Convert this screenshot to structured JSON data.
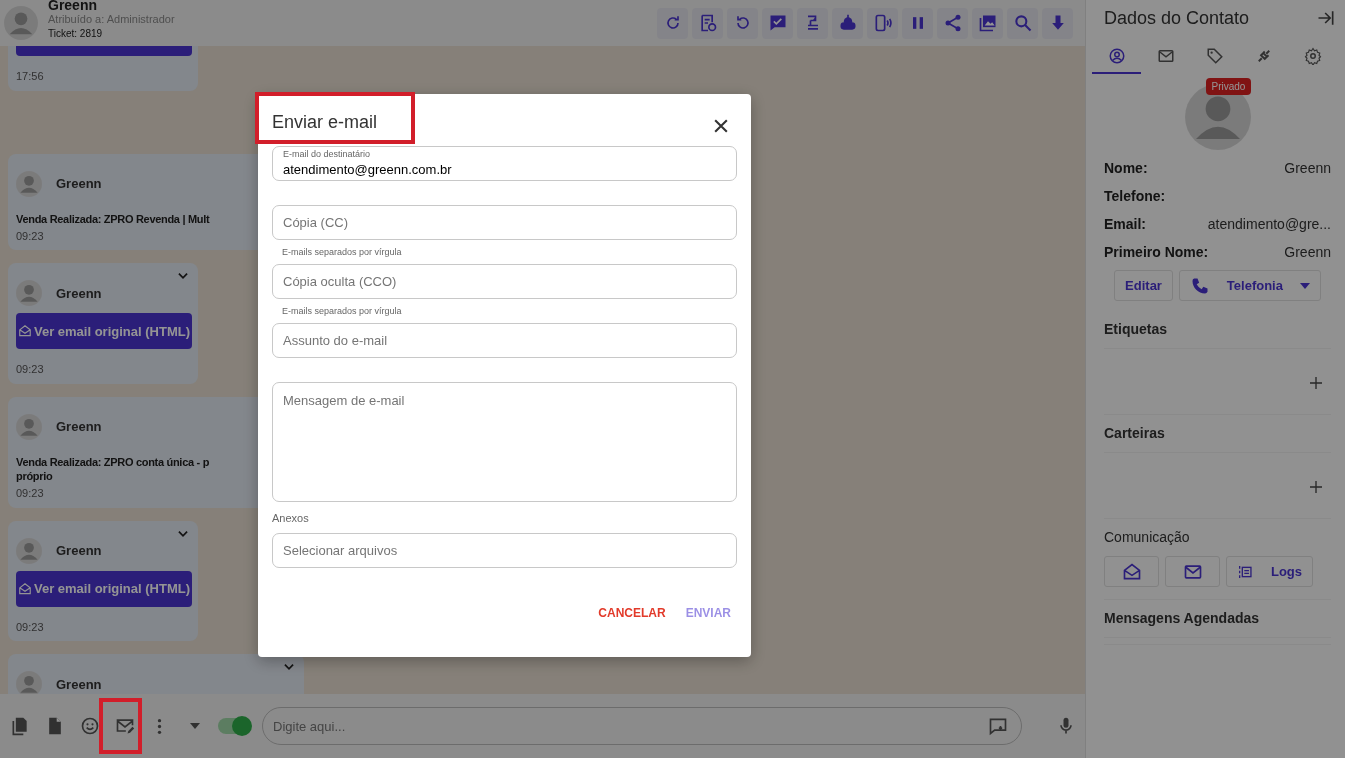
{
  "header": {
    "contact_name": "Greenn",
    "assigned": "Atribuído a: Administrador",
    "ticket": "Ticket: 2819"
  },
  "messages": [
    {
      "kind": "email_link_cut",
      "time": "17:56",
      "has_menu": false
    },
    {
      "kind": "text",
      "sender": "Greenn",
      "lines": [
        "Venda Realizada: ZPRO Revenda | Mult"
      ],
      "time": "09:23",
      "has_menu": false
    },
    {
      "kind": "email_link",
      "sender": "Greenn",
      "button": "Ver email original (HTML)",
      "time": "09:23",
      "has_menu": true
    },
    {
      "kind": "text",
      "sender": "Greenn",
      "lines": [
        "Venda Realizada: ZPRO conta única - p",
        "próprio"
      ],
      "time": "09:23",
      "has_menu": false
    },
    {
      "kind": "email_link",
      "sender": "Greenn",
      "button": "Ver email original (HTML)",
      "time": "09:23",
      "has_menu": true
    },
    {
      "kind": "partial",
      "sender": "Greenn",
      "has_menu": true
    }
  ],
  "composer": {
    "placeholder": "Digite aqui...",
    "signature_on": true
  },
  "contact_panel": {
    "title": "Dados do Contato",
    "tabs": [
      {
        "selected": true
      },
      {
        "selected": false
      },
      {
        "selected": false
      },
      {
        "selected": false
      },
      {
        "selected": false
      }
    ],
    "badge": "Privado",
    "fields": [
      {
        "label": "Nome:",
        "value": "Greenn"
      },
      {
        "label": "Telefone:"
      },
      {
        "label": "Email:",
        "value": "atendimento@gre..."
      },
      {
        "label": "Primeiro Nome:",
        "value": "Greenn"
      }
    ],
    "edit_button": "Editar",
    "phone_button": "Telefonia",
    "sections": [
      {
        "kind": "add",
        "title": "Etiquetas"
      },
      {
        "kind": "add",
        "title": "Carteiras"
      },
      {
        "kind": "comm",
        "title": "Comunicação",
        "logs_button": "Logs"
      },
      {
        "kind": "plain",
        "title": "Mensagens Agendadas"
      }
    ]
  },
  "modal": {
    "title": "Enviar e-mail",
    "fields": [
      {
        "kind": "floating",
        "label": "E-mail do destinatário",
        "value": "atendimento@greenn.com.br"
      },
      {
        "kind": "input",
        "placeholder": "Cópia (CC)",
        "hint": "E-mails separados por vírgula"
      },
      {
        "kind": "input",
        "placeholder": "Cópia oculta (CCO)",
        "hint": "E-mails separados por vírgula"
      },
      {
        "kind": "input",
        "placeholder": "Assunto do e-mail"
      },
      {
        "kind": "textarea",
        "placeholder": "Mensagem de e-mail"
      },
      {
        "kind": "file",
        "label": "Anexos",
        "placeholder": "Selecionar arquivos"
      }
    ],
    "actions": [
      {
        "kind": "cancel",
        "label": "CANCELAR",
        "disabled": false
      },
      {
        "kind": "submit",
        "label": "ENVIAR",
        "disabled": true
      }
    ]
  }
}
